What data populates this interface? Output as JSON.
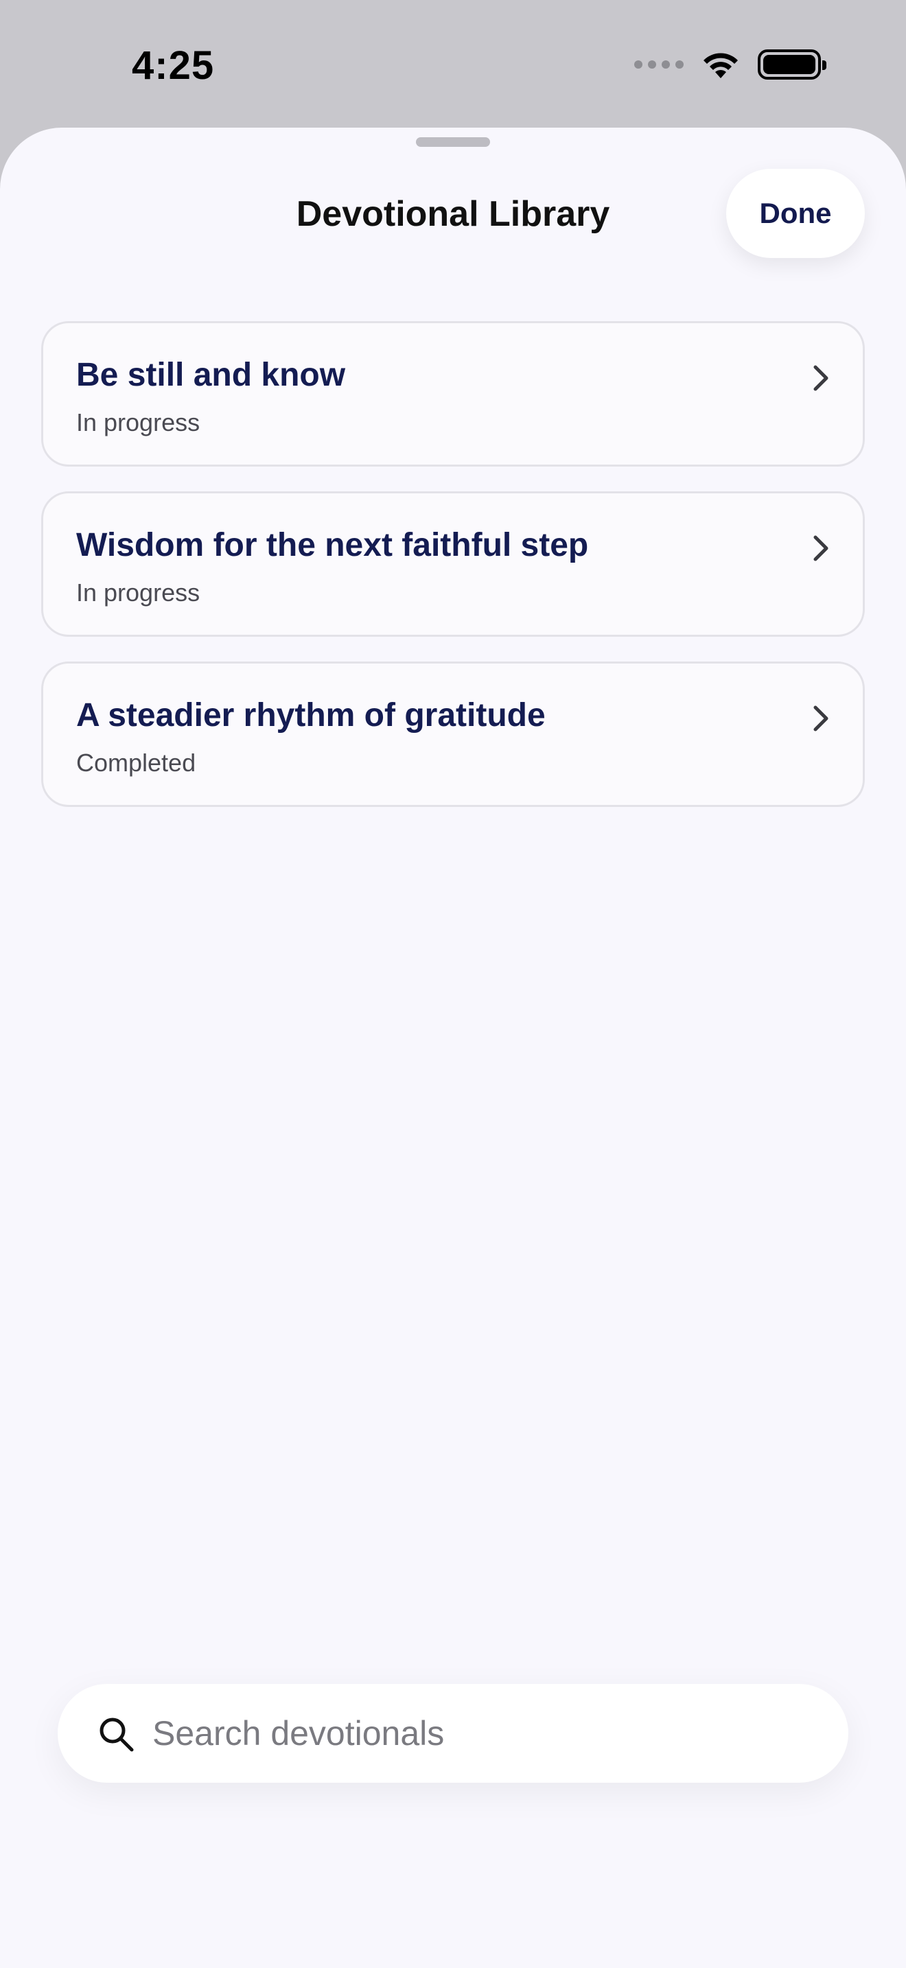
{
  "status_bar": {
    "time": "4:25"
  },
  "sheet": {
    "title": "Devotional Library",
    "done_label": "Done"
  },
  "devotionals": [
    {
      "title": "Be still and know",
      "status": "In progress"
    },
    {
      "title": "Wisdom for the next faithful step",
      "status": "In progress"
    },
    {
      "title": "A steadier rhythm of gratitude",
      "status": "Completed"
    }
  ],
  "search": {
    "placeholder": "Search devotionals",
    "value": ""
  },
  "icons": {
    "chevron": "chevron-right-icon",
    "search": "search-icon",
    "wifi": "wifi-icon",
    "battery": "battery-icon",
    "signal": "signal-icon"
  },
  "colors": {
    "title_text": "#141c52",
    "sheet_background": "#f8f7fd",
    "status_bar_background": "#c8c7cc"
  }
}
